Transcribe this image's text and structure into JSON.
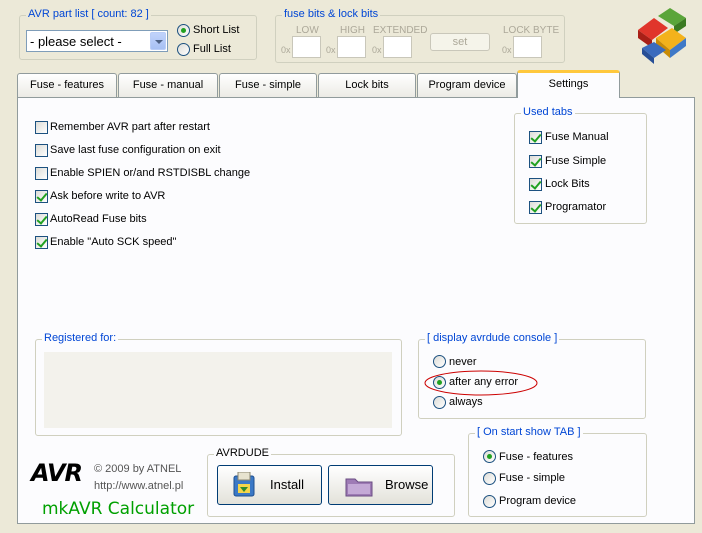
{
  "part_list": {
    "title": "AVR part list [ count: 82 ]",
    "select_value": "- please select -",
    "short_list": "Short List",
    "full_list": "Full List"
  },
  "fuse_bits": {
    "title": "fuse bits & lock bits",
    "low": "LOW",
    "high": "HIGH",
    "extended": "EXTENDED",
    "lock_byte": "LOCK BYTE",
    "hex_prefix": "0x",
    "set_label": "set"
  },
  "tabs": [
    {
      "label": "Fuse - features"
    },
    {
      "label": "Fuse - manual"
    },
    {
      "label": "Fuse - simple"
    },
    {
      "label": "Lock bits"
    },
    {
      "label": "Program device"
    },
    {
      "label": "Settings"
    }
  ],
  "settings": {
    "options": [
      {
        "label": "Remember AVR part after restart",
        "checked": false
      },
      {
        "label": "Save last fuse configuration on exit",
        "checked": false
      },
      {
        "label": "Enable SPIEN or/and RSTDISBL change",
        "checked": false
      },
      {
        "label": "Ask before write to AVR",
        "checked": true
      },
      {
        "label": "AutoRead Fuse bits",
        "checked": true
      },
      {
        "label": "Enable \"Auto SCK speed\"",
        "checked": true
      }
    ]
  },
  "used_tabs": {
    "title": "Used tabs",
    "items": [
      {
        "label": "Fuse Manual",
        "checked": true
      },
      {
        "label": "Fuse Simple",
        "checked": true
      },
      {
        "label": "Lock Bits",
        "checked": true
      },
      {
        "label": "Programator",
        "checked": true
      }
    ]
  },
  "registered": {
    "title": "Registered for:"
  },
  "console": {
    "title": "[ display avrdude console ]",
    "options": [
      {
        "label": "never",
        "selected": false
      },
      {
        "label": "after any error",
        "selected": true
      },
      {
        "label": "always",
        "selected": false
      }
    ],
    "highlight_color": "#cc0000"
  },
  "start_tab": {
    "title": "[ On start show TAB ]",
    "options": [
      {
        "label": "Fuse - features",
        "selected": true
      },
      {
        "label": "Fuse - simple",
        "selected": false
      },
      {
        "label": "Program device",
        "selected": false
      }
    ]
  },
  "branding": {
    "logo": "AVR",
    "copyright": "©  2009 by ATNEL",
    "url": "http://www.atnel.pl",
    "app_name": "mkAVR Calculator",
    "app_name_color": "#00a000"
  },
  "avrdude": {
    "title": "AVRDUDE",
    "install": "Install",
    "browse": "Browse"
  },
  "colors": {
    "groupbox_title": "#0046d5",
    "active_tab_accent": "#ffc83c",
    "check_green": "#21a121"
  }
}
